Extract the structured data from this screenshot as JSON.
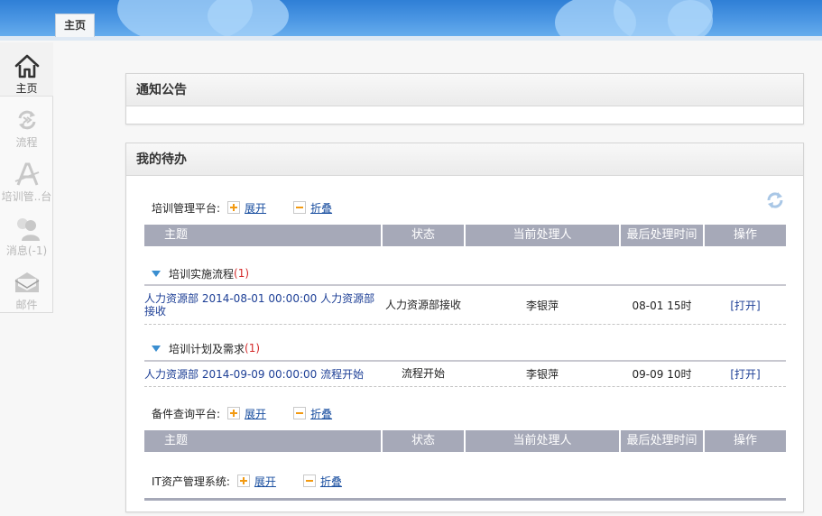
{
  "header": {
    "tab_label": "主页"
  },
  "sidebar": {
    "items": [
      {
        "label": "主页",
        "icon": "home-icon",
        "active": true
      },
      {
        "label": "流程",
        "icon": "process-icon",
        "active": false
      },
      {
        "label": "培训管..台",
        "icon": "training-icon",
        "active": false
      },
      {
        "label": "消息(-1)",
        "icon": "user-message-icon",
        "active": false
      },
      {
        "label": "邮件",
        "icon": "mail-icon",
        "active": false
      }
    ]
  },
  "notice": {
    "title": "通知公告"
  },
  "todo": {
    "title": "我的待办",
    "refresh_icon": "refresh-icon",
    "columns": [
      "主题",
      "状态",
      "当前处理人",
      "最后处理时间",
      "操作"
    ],
    "expand_label": "展开",
    "collapse_label": "折叠",
    "platforms": [
      {
        "name": "培训管理平台:",
        "groups": [
          {
            "name": "培训实施流程",
            "count": "(1)",
            "rows": [
              {
                "subject": "人力资源部 2014-08-01 00:00:00 人力资源部接收",
                "status": "人力资源部接收",
                "handler": "李银萍",
                "time": "08-01 15时",
                "action": "[打开]"
              }
            ]
          },
          {
            "name": "培训计划及需求",
            "count": "(1)",
            "rows": [
              {
                "subject": "人力资源部 2014-09-09 00:00:00 流程开始",
                "status": "流程开始",
                "handler": "李银萍",
                "time": "09-09 10时",
                "action": "[打开]"
              }
            ]
          }
        ]
      },
      {
        "name": "备件查询平台:",
        "groups": []
      },
      {
        "name": "IT资产管理系统:",
        "groups": []
      }
    ]
  },
  "colors": {
    "banner": "#4d98e4",
    "table_header": "#a6a9b8",
    "link": "#1d3f96",
    "accent_orange": "#f29a12",
    "count_red": "#d42a2a"
  }
}
